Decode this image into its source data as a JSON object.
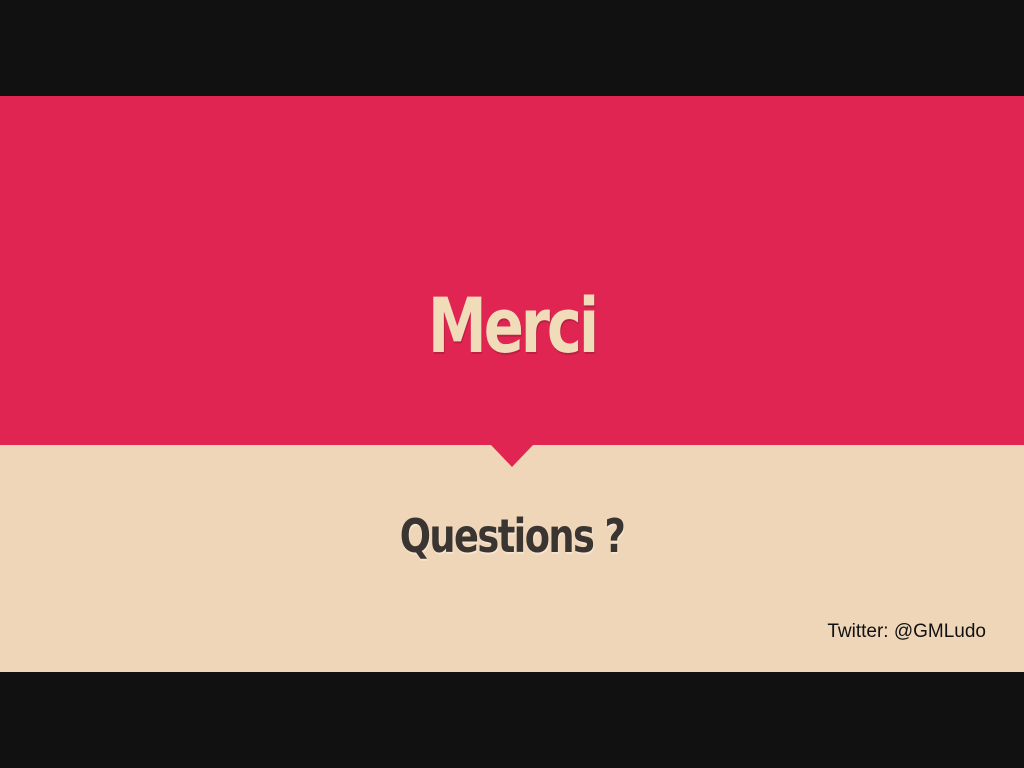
{
  "slide": {
    "title": "Merci",
    "subtitle": "Questions ?",
    "footer": "Twitter: @GMLudo"
  },
  "colors": {
    "accent": "#e02553",
    "background_light": "#f0d6b8",
    "title_text": "#f0dcb9",
    "subtitle_text": "#3a3530",
    "letterbox": "#111111"
  }
}
